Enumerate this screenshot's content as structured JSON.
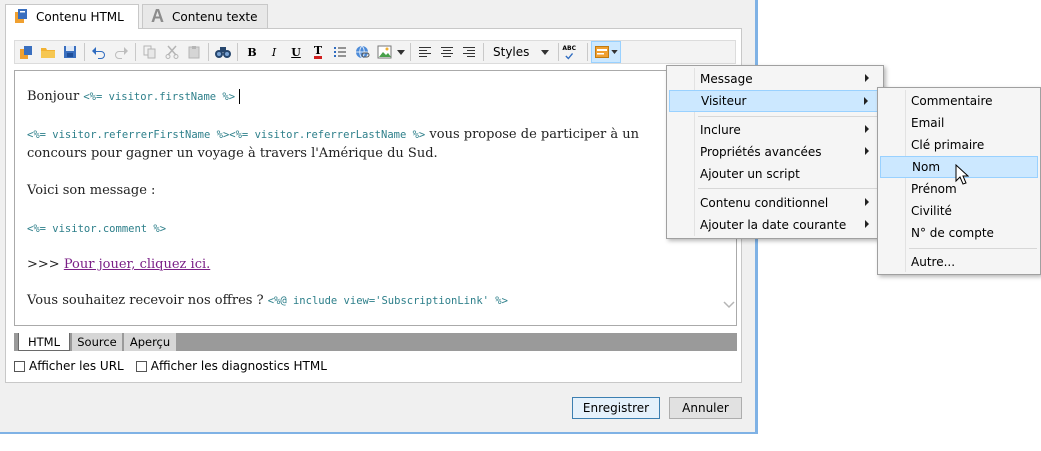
{
  "tabs": {
    "html_label": "Contenu HTML",
    "text_label": "Contenu texte",
    "text_icon_letter": "A"
  },
  "toolbar": {
    "buttons": [
      "new-icon",
      "open-folder-icon",
      "save-icon",
      "undo-icon",
      "redo-icon",
      "copy-icon",
      "cut-icon",
      "paste-icon",
      "find-icon",
      "bold-icon",
      "italic-icon",
      "underline-icon",
      "text-color-icon",
      "list-icon",
      "link-icon",
      "image-icon",
      "align-left-icon",
      "align-center-icon",
      "align-right-icon",
      "spellcheck-icon",
      "personalization-icon"
    ],
    "bold": "B",
    "italic": "I",
    "underline": "U",
    "text_color": "T",
    "styles_label": "Styles",
    "spell_label": "ABC"
  },
  "editor": {
    "greeting": "Bonjour",
    "greeting_code": "<%= visitor.firstName %>",
    "line2_code": "<%= visitor.referrerFirstName %><%= visitor.referrerLastName %>",
    "line2_text": "vous propose de participer à un",
    "line3_text": "concours pour gagner un voyage à travers l'Amérique du Sud.",
    "line4_text": "Voici son message :",
    "line5_code": "<%= visitor.comment %>",
    "line6_prefix": ">>>",
    "line6_link": "Pour jouer, cliquez ici.",
    "line7_text": "Vous souhaitez recevoir nos offres ?",
    "line7_code": "<%@ include view='SubscriptionLink' %>"
  },
  "view_tabs": [
    "HTML",
    "Source",
    "Aperçu"
  ],
  "options": {
    "show_urls": "Afficher les URL",
    "show_diagnostics": "Afficher les diagnostics HTML"
  },
  "buttons": {
    "save": "Enregistrer",
    "cancel": "Annuler"
  },
  "menu_main": {
    "items": [
      "Message",
      "Visiteur",
      "Inclure",
      "Propriétés avancées",
      "Ajouter un script",
      "Contenu conditionnel",
      "Ajouter la date courante"
    ]
  },
  "menu_sub": {
    "items": [
      "Commentaire",
      "Email",
      "Clé primaire",
      "Nom",
      "Prénom",
      "Civilité",
      "N° de compte",
      "Autre..."
    ]
  },
  "colors": {
    "accent": "#3c7fb1",
    "highlight": "#cce8ff",
    "code": "#2d7f8a",
    "link": "#7a1f86"
  }
}
